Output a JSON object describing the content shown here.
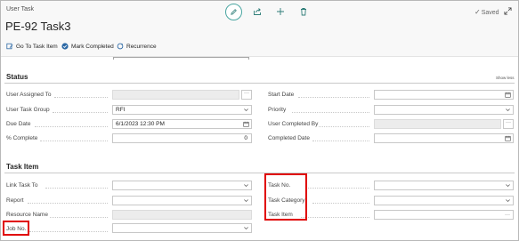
{
  "header": {
    "breadcrumb": "User Task",
    "title": "PE-92 Task3",
    "saved_label": "Saved"
  },
  "icons": {
    "edit": "pencil-icon",
    "share": "share-icon",
    "new": "plus-icon",
    "delete": "trash-icon",
    "saved": "check-icon",
    "expand": "expand-icon"
  },
  "actions": [
    {
      "label": "Go To Task Item",
      "icon": "task-item-icon"
    },
    {
      "label": "Mark Completed",
      "icon": "check-circle-icon"
    },
    {
      "label": "Recurrence",
      "icon": "recurrence-icon"
    }
  ],
  "status_section": {
    "title": "Status",
    "show_less": "Show less",
    "left": [
      {
        "label": "User Assigned To",
        "value": "",
        "control": "lookup",
        "readonly": true
      },
      {
        "label": "User Task Group",
        "value": "RFI",
        "control": "dropdown"
      },
      {
        "label": "Due Date",
        "value": "6/1/2023 12:30 PM",
        "control": "date"
      },
      {
        "label": "% Complete",
        "value": "0",
        "control": "number"
      }
    ],
    "right": [
      {
        "label": "Start Date",
        "value": "",
        "control": "date"
      },
      {
        "label": "Priority",
        "value": "",
        "control": "dropdown"
      },
      {
        "label": "User Completed By",
        "value": "",
        "control": "lookup",
        "readonly": true
      },
      {
        "label": "Completed Date",
        "value": "",
        "control": "date"
      }
    ]
  },
  "task_item_section": {
    "title": "Task Item",
    "left": [
      {
        "label": "Link Task To",
        "value": "",
        "control": "dropdown"
      },
      {
        "label": "Report",
        "value": "",
        "control": "dropdown"
      },
      {
        "label": "Resource Name",
        "value": "",
        "control": "text",
        "readonly": true
      },
      {
        "label": "Job No.",
        "value": "",
        "control": "dropdown"
      }
    ],
    "right": [
      {
        "label": "Task No.",
        "value": "",
        "control": "dropdown"
      },
      {
        "label": "Task Category",
        "value": "",
        "control": "dropdown"
      },
      {
        "label": "Task Item",
        "value": "",
        "control": "lookup"
      }
    ]
  },
  "colors": {
    "highlight": "#e00000",
    "accent": "#4aa6a1"
  }
}
